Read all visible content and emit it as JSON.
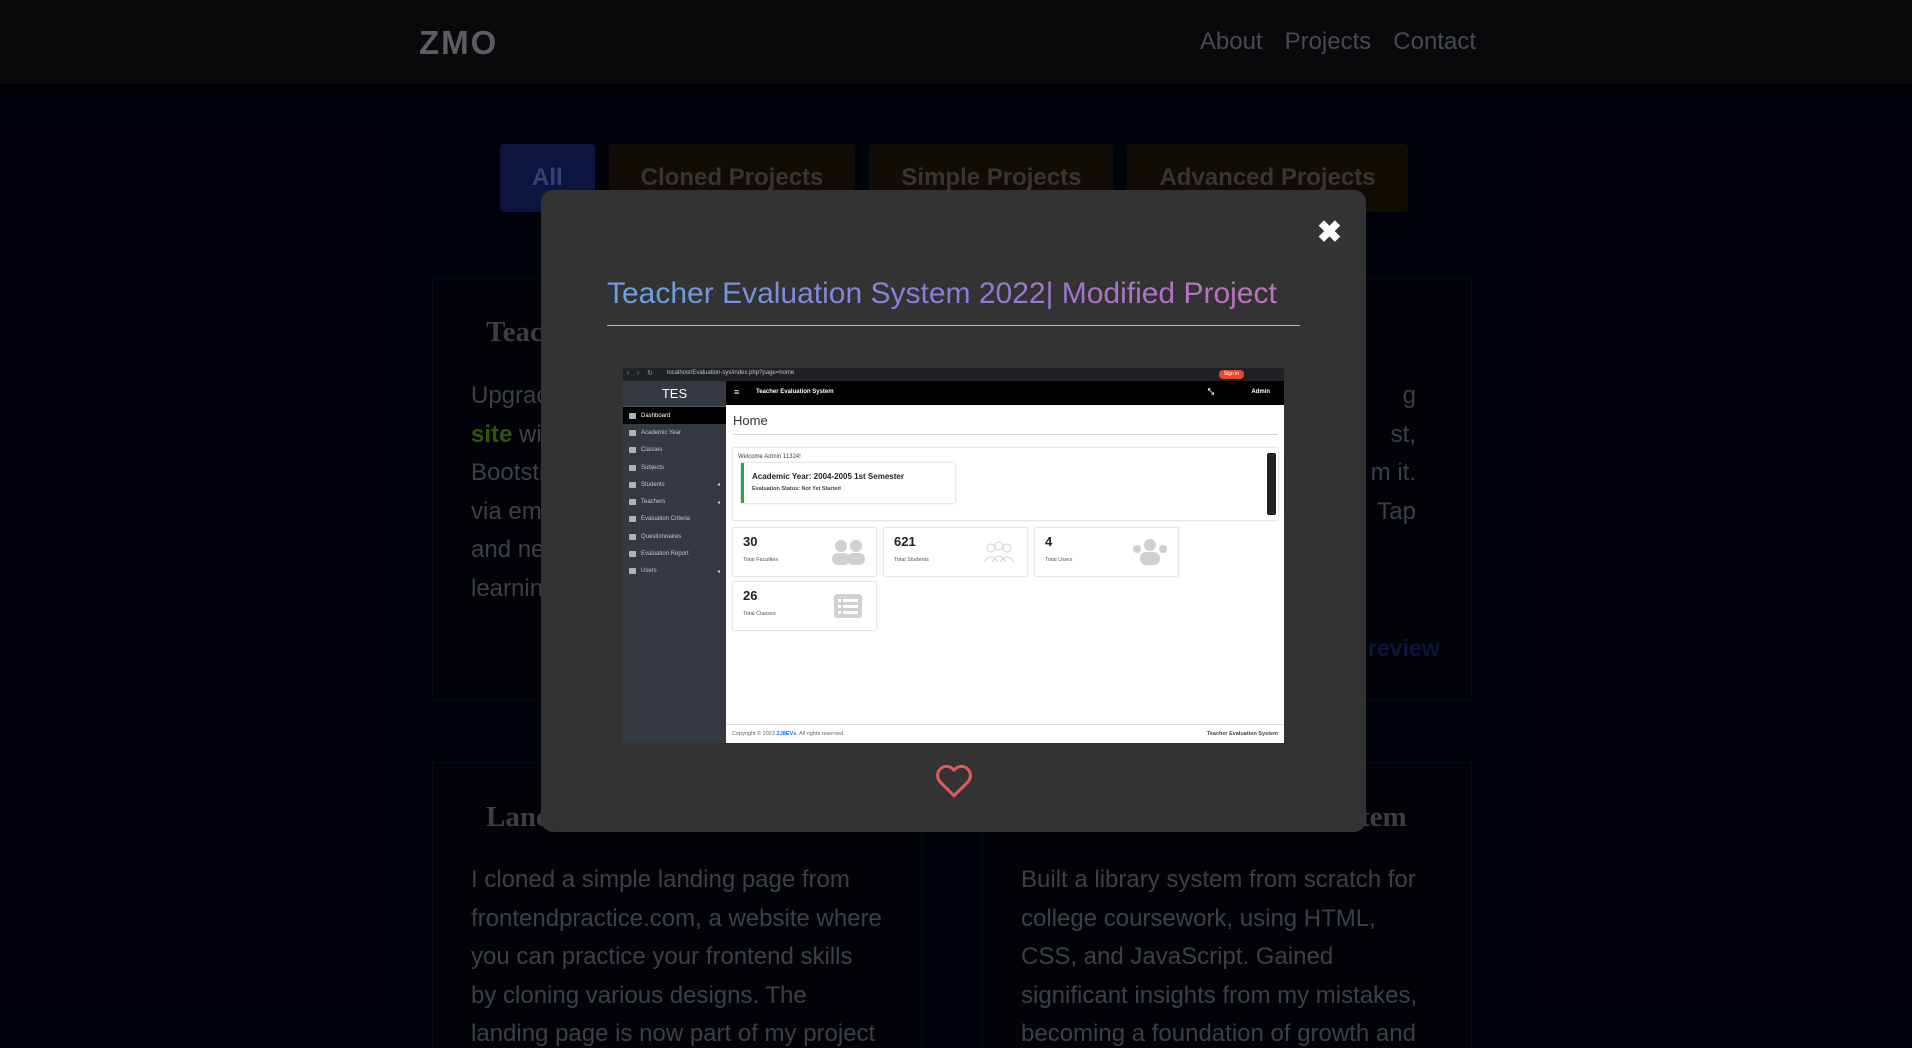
{
  "nav": {
    "logo": "ZMO",
    "links": [
      "About",
      "Projects",
      "Contact"
    ]
  },
  "filters": [
    "All",
    "Cloned Projects",
    "Simple Projects",
    "Advanced Projects"
  ],
  "cards": {
    "card1": {
      "title_fragment": "Teac",
      "lines": [
        "Upgrac",
        "wi",
        "Bootstr",
        "via em",
        "and ne",
        "learnin"
      ],
      "highlight": "site"
    },
    "card2": {
      "lines": [
        "g",
        "st,",
        "m it.",
        "Tap"
      ],
      "preview_fragment": "review"
    },
    "card3": {
      "title_fragment": "Lanc",
      "lines": [
        "I cloned a simple landing page from",
        "frontendpractice.com, a website where",
        "you can practice your frontend skills",
        "by cloning various designs. The",
        "landing page is now part of my project"
      ]
    },
    "card4": {
      "title_fragment": "tem",
      "lines": [
        "Built a library system from scratch for",
        "college coursework, using HTML,",
        "CSS, and JavaScript. Gained",
        "significant insights from my mistakes,",
        "becoming a foundation of growth and"
      ]
    }
  },
  "modal": {
    "close_symbol": "✖",
    "title": "Teacher Evaluation System 2022| Modified Project",
    "heart_icon": "heart-outline",
    "heart_color": "#e05a5a",
    "screenshot": {
      "url": "localhost/Evaluation-sys/index.php?page=home",
      "signin": "Sign in",
      "brand": "TES",
      "topbar_title": "Teacher Evaluation System",
      "admin_label": "Admin",
      "menu": [
        "Dashboard",
        "Academic Year",
        "Classes",
        "Subjects",
        "Students",
        "Teachers",
        "Evaluation Criteria",
        "Questionnaires",
        "Evaluation Report",
        "Users"
      ],
      "page_heading": "Home",
      "welcome": "Welcome Admin 11324!",
      "academic_year": "Academic Year: 2004-2005 1st Semester",
      "evaluation_status": "Evaluation Status: Not Yet Started",
      "stats": [
        {
          "value": "30",
          "label": "Total Faculties"
        },
        {
          "value": "621",
          "label": "Total Students"
        },
        {
          "value": "4",
          "label": "Total Users"
        },
        {
          "value": "26",
          "label": "Total Classes"
        }
      ],
      "footer_left_prefix": "Copyright © 2023",
      "footer_left_brand": "ZJ8EVs",
      "footer_left_suffix": ". All rights reserved.",
      "footer_right": "Teacher Evaluation System"
    }
  }
}
